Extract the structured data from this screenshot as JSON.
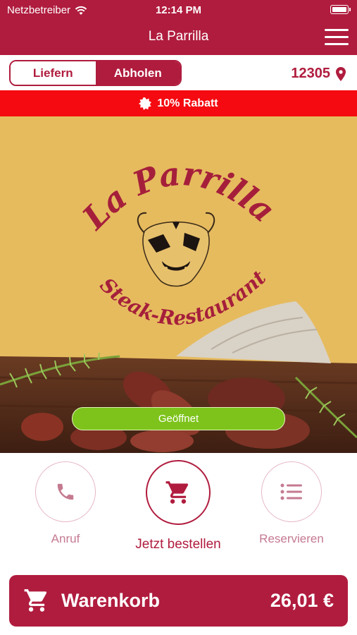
{
  "status_bar": {
    "carrier": "Netzbetreiber",
    "time": "12:14 PM"
  },
  "nav": {
    "title": "La Parrilla"
  },
  "mode_toggle": {
    "deliver_label": "Liefern",
    "pickup_label": "Abholen",
    "selected": "Abholen"
  },
  "location": {
    "postal_code": "12305"
  },
  "promo": {
    "text": "10% Rabatt"
  },
  "hero": {
    "logo_title": "La Parrilla",
    "logo_subtitle": "Steak-Restaurant",
    "status_label": "Geöffnet"
  },
  "actions": {
    "call_label": "Anruf",
    "order_label": "Jetzt bestellen",
    "reserve_label": "Reservieren"
  },
  "cart": {
    "label": "Warenkorb",
    "total": "26,01 €"
  },
  "colors": {
    "brand": "#b01c3e",
    "promo": "#f40a10",
    "open": "#7dc31b",
    "hero_bg": "#e6bb5e"
  }
}
